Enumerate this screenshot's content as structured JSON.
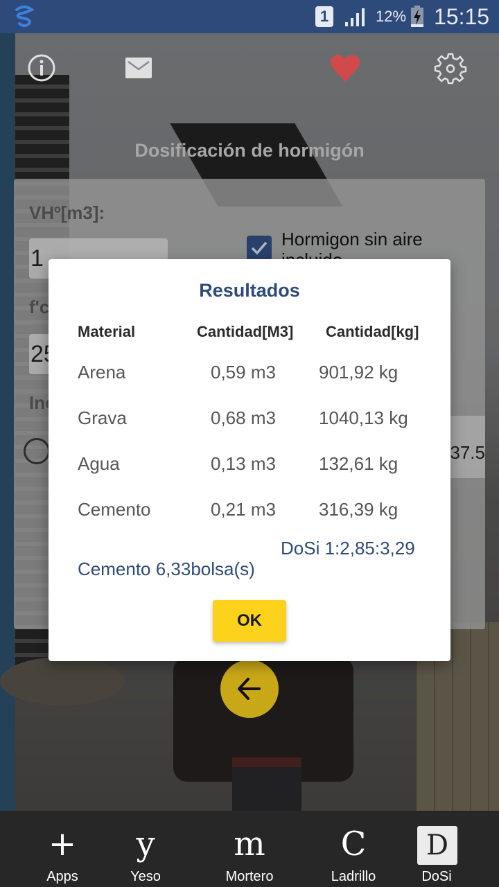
{
  "status_bar": {
    "sim_slot": "1",
    "battery_percent": "12%",
    "time": "15:15"
  },
  "app": {
    "title": "Dosificación de hormigón",
    "accent_color": "#2e4a7b",
    "button_color": "#fcd21c"
  },
  "toolbar": {
    "icons": [
      "info-icon",
      "mail-icon",
      "heart-icon",
      "gear-icon"
    ]
  },
  "form": {
    "volume_label": "VHº[m3]:",
    "volume_value": "1",
    "fc_label": "f'c",
    "fc_value": "25",
    "inc_label": "Inc",
    "air_checkbox_label": "Hormigon sin aire incluido",
    "air_checkbox_checked": true,
    "side_value": "37.5"
  },
  "dialog": {
    "title": "Resultados",
    "columns": [
      "Material",
      "Cantidad[M3]",
      "Cantidad[kg]"
    ],
    "rows": [
      {
        "material": "Arena",
        "m3": "0,59 m3",
        "kg": "901,92 kg"
      },
      {
        "material": "Grava",
        "m3": "0,68 m3",
        "kg": "1040,13 kg"
      },
      {
        "material": "Agua",
        "m3": "0,13 m3",
        "kg": "132,61 kg"
      },
      {
        "material": "Cemento",
        "m3": "0,21 m3",
        "kg": "316,39 kg"
      }
    ],
    "ratio": "DoSi 1:2,85:3,29",
    "cement_bags": "Cemento 6,33bolsa(s)",
    "ok_label": "OK"
  },
  "bottom_nav": {
    "items": [
      {
        "label": "Apps",
        "glyph": "+"
      },
      {
        "label": "Yeso",
        "glyph": "y"
      },
      {
        "label": "Mortero",
        "glyph": "m"
      },
      {
        "label": "Ladrillo",
        "glyph": "C"
      },
      {
        "label": "DoSi",
        "glyph": "D",
        "active": true
      }
    ]
  }
}
